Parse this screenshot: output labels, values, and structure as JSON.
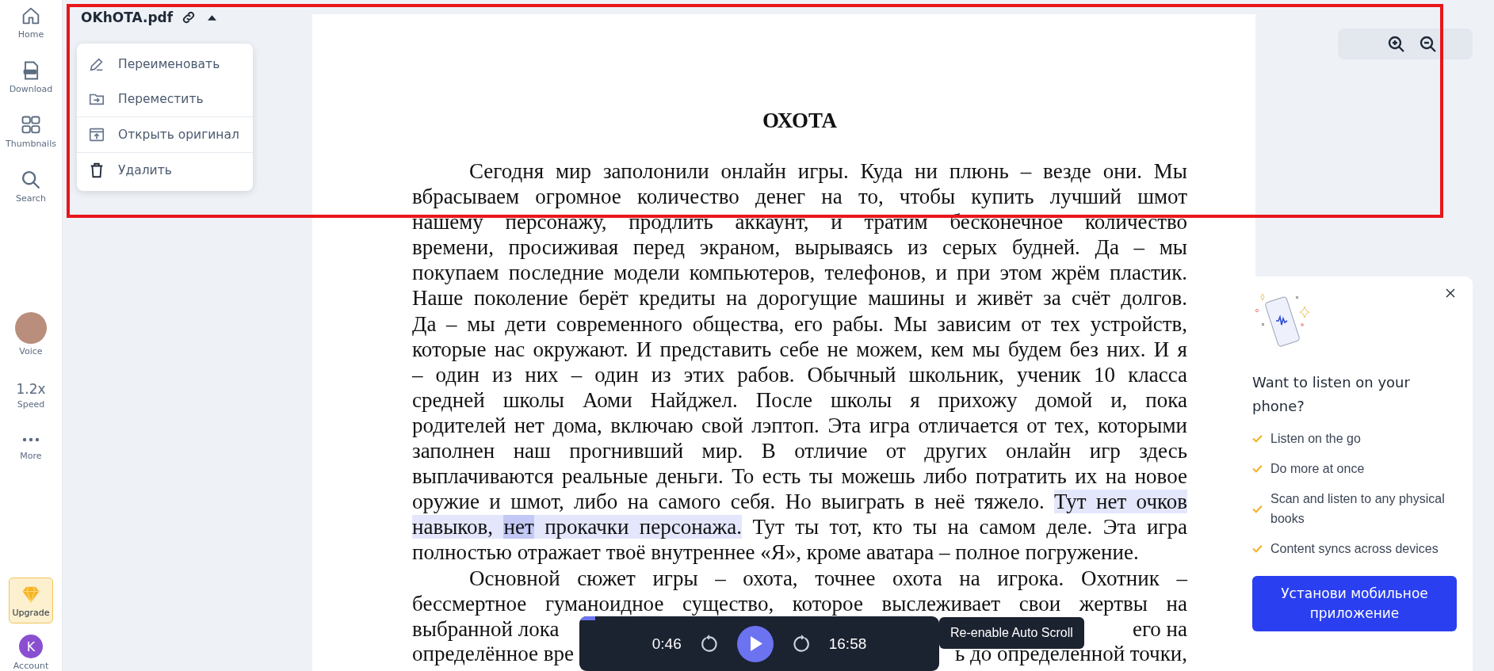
{
  "sidebar": {
    "items": [
      {
        "label": "Home",
        "kind": "home"
      },
      {
        "label": "Download",
        "kind": "download"
      },
      {
        "label": "Thumbnails",
        "kind": "thumbnails"
      },
      {
        "label": "Search",
        "kind": "search"
      }
    ],
    "player_items": [
      {
        "label": "Voice",
        "kind": "voice"
      },
      {
        "label": "Speed",
        "kind": "speed",
        "value": "1.2x"
      },
      {
        "label": "More",
        "kind": "more"
      }
    ],
    "bottom_items": [
      {
        "label": "Upgrade",
        "kind": "upgrade"
      },
      {
        "label": "Account",
        "kind": "account",
        "initial": "K"
      }
    ]
  },
  "file": {
    "name": "OKhOTA.pdf",
    "expanded": true
  },
  "file_menu": [
    {
      "label": "Переименовать",
      "kind": "rename",
      "separated": false
    },
    {
      "label": "Переместить",
      "kind": "move",
      "separated": false
    },
    {
      "label": "Открыть оригинал",
      "kind": "open",
      "separated": true
    },
    {
      "label": "Удалить",
      "kind": "delete",
      "separated": true
    }
  ],
  "document": {
    "title": "ОХОТА",
    "paragraph_1": [
      [
        {
          "text": "Сегодня мир заполонили онлайн игры. Куда ни плюнь – везде они. Мы",
          "highlighted": false,
          "current": false
        }
      ],
      [
        {
          "text": "вбрасываем огромное количество денег на то, чтобы купить лучший шмот",
          "highlighted": false,
          "current": false
        }
      ],
      [
        {
          "text": "нашему персонажу, продлить аккаунт, и тратим бесконечное количество",
          "highlighted": false,
          "current": false
        }
      ],
      [
        {
          "text": "времени, просиживая перед экраном, вырываясь из серых будней. Да – мы",
          "highlighted": false,
          "current": false
        }
      ],
      [
        {
          "text": "покупаем последние модели компьютеров, телефонов, и при этом жрём пластик.",
          "highlighted": false,
          "current": false
        }
      ],
      [
        {
          "text": "Наше поколение берёт кредиты на дорогущие машины и живёт за счёт долгов.",
          "highlighted": false,
          "current": false
        }
      ],
      [
        {
          "text": "Да – мы дети современного общества, его рабы. Мы зависим от тех устройств,",
          "highlighted": false,
          "current": false
        }
      ],
      [
        {
          "text": "которые нас окружают. И представить себе не можем, кем мы будем без них. И я",
          "highlighted": false,
          "current": false
        }
      ],
      [
        {
          "text": "– один из них – один из этих рабов. Обычный школьник, ученик 10 класса",
          "highlighted": false,
          "current": false
        }
      ],
      [
        {
          "text": "средней школы Аоми Найджел. После школы я прихожу домой и, пока",
          "highlighted": false,
          "current": false
        }
      ],
      [
        {
          "text": "родителей нет дома, включаю свой лэптоп. Эта игра отличается от тех, которыми",
          "highlighted": false,
          "current": false
        }
      ],
      [
        {
          "text": "заполнен наш прогнивший мир. В отличие от других онлайн игр здесь",
          "highlighted": false,
          "current": false
        }
      ],
      [
        {
          "text": "выплачиваются реальные деньги. То есть ты можешь либо потратить их на новое",
          "highlighted": false,
          "current": false
        }
      ],
      [
        {
          "text": "оружие и шмот, либо на самого себя. Но выиграть в неё тяжело. ",
          "highlighted": false,
          "current": false
        },
        {
          "text": "Тут нет очков",
          "highlighted": true,
          "current": false
        }
      ],
      [
        {
          "text": "навыков, ",
          "highlighted": true,
          "current": false
        },
        {
          "text": "нет",
          "highlighted": true,
          "current": true
        },
        {
          "text": " прокачки персонажа.",
          "highlighted": true,
          "current": false
        },
        {
          "text": " Тут ты тот, кто ты на самом деле. Эта игра",
          "highlighted": false,
          "current": false
        }
      ],
      [
        {
          "text": "полностью отражает твоё внутреннее «Я», кроме аватара – полное погружение.",
          "highlighted": false,
          "current": false
        }
      ]
    ],
    "paragraph_2": {
      "lines": [
        "Основной сюжет игры – охота, точнее охота на игрока. Охотник –",
        "бессмертное гуманоидное существо, которое выслеживает свои жертвы на"
      ],
      "covered_lines": [
        [
          "выбранной лока",
          "его на"
        ],
        [
          "определённое вре",
          "ь до определённой точки,"
        ]
      ]
    }
  },
  "player": {
    "elapsed": "0:46",
    "duration": "16:58",
    "level": 0.045,
    "playing": false
  },
  "tooltip": "Re-enable Auto Scroll",
  "promo": {
    "title": "Want to listen on your phone?",
    "features": [
      "Listen on the go",
      "Do more at once",
      "Scan and listen to any physical books",
      "Content syncs across devices"
    ],
    "button": "Установи мобильное приложение"
  }
}
